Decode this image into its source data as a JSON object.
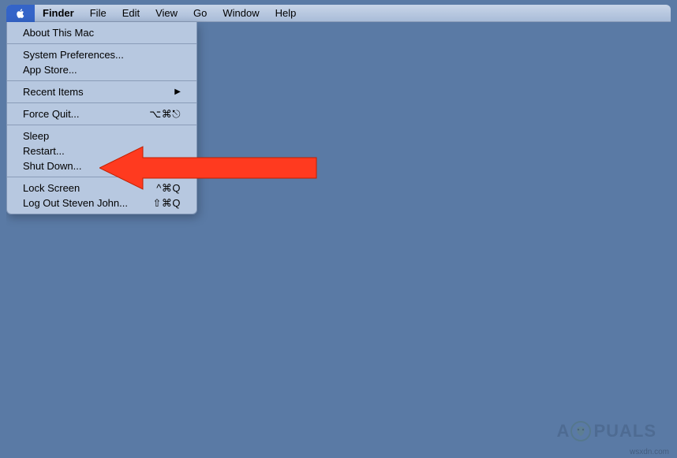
{
  "menu_bar": {
    "app_name": "Finder",
    "items": [
      "File",
      "Edit",
      "View",
      "Go",
      "Window",
      "Help"
    ]
  },
  "apple_menu": {
    "about": "About This Mac",
    "system_prefs": "System Preferences...",
    "app_store": "App Store...",
    "recent_items": "Recent Items",
    "force_quit": "Force Quit...",
    "force_quit_shortcut": "⌥⌘⎋",
    "sleep": "Sleep",
    "restart": "Restart...",
    "shut_down": "Shut Down...",
    "lock_screen": "Lock Screen",
    "lock_screen_shortcut": "^⌘Q",
    "log_out": "Log Out Steven John...",
    "log_out_shortcut": "⇧⌘Q"
  },
  "watermark": {
    "text_before": "A",
    "text_after": "PUALS"
  },
  "attribution": "wsxdn.com"
}
